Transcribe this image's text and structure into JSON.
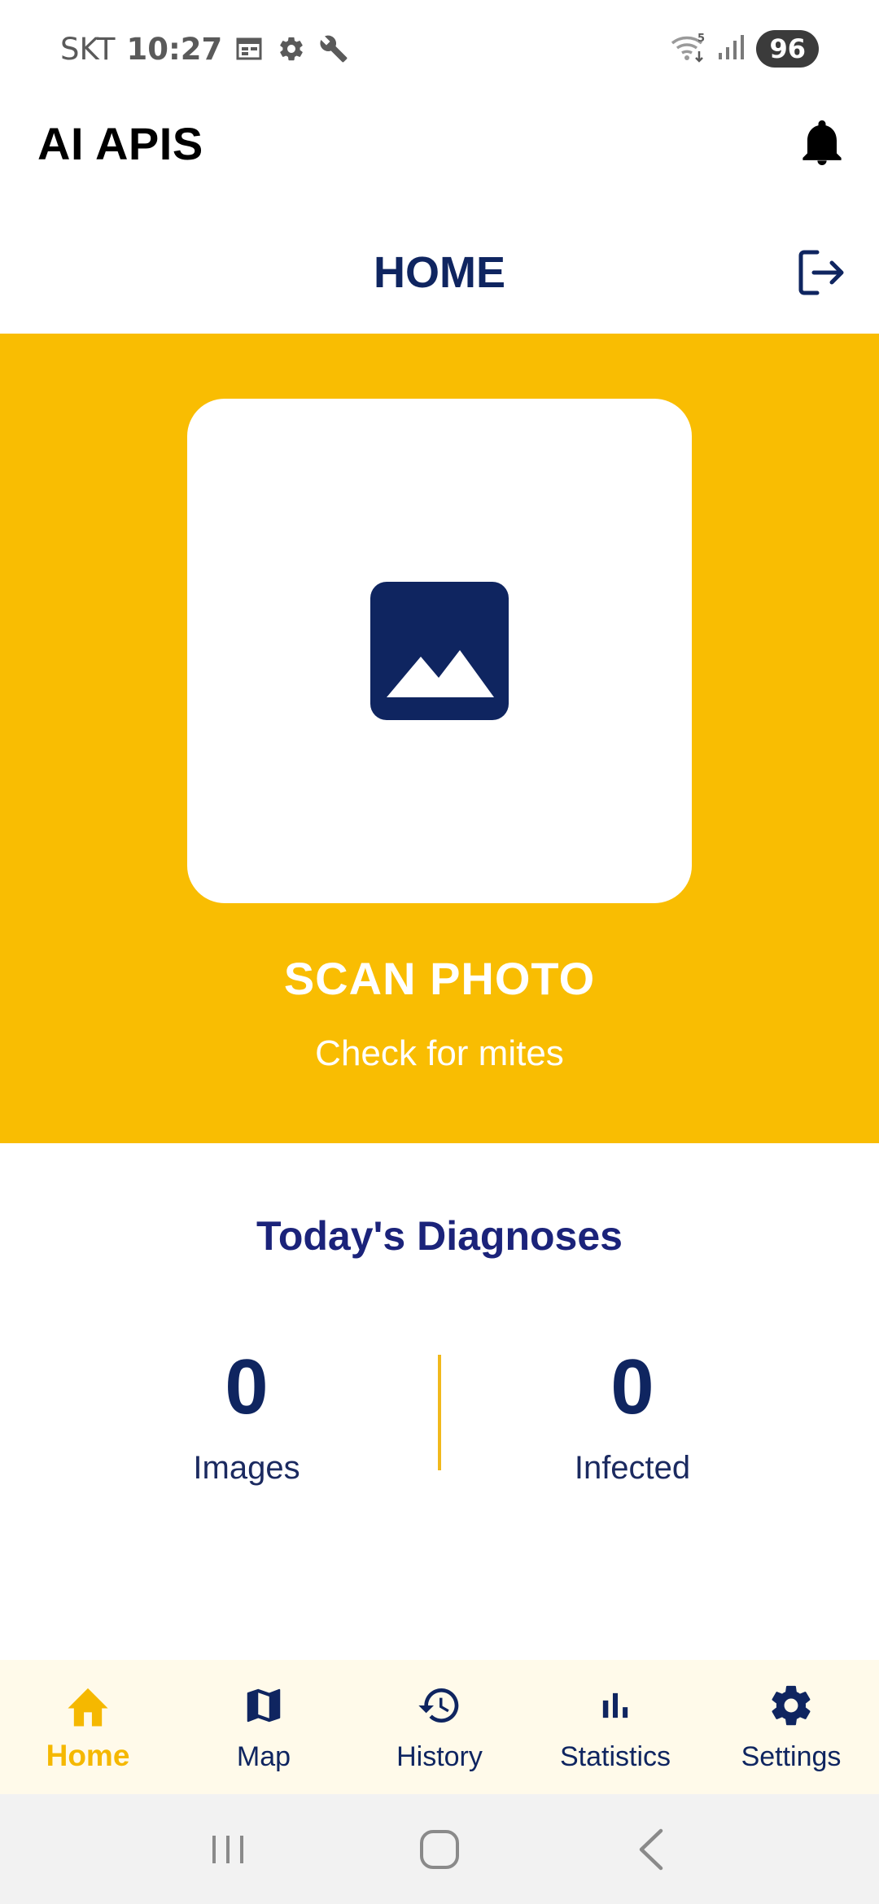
{
  "status_bar": {
    "carrier": "SKT",
    "time": "10:27",
    "battery": "96",
    "icons": [
      "calendar-icon",
      "gear-icon",
      "wrench-icon",
      "wifi-icon",
      "signal-icon"
    ]
  },
  "app": {
    "title": "AI APIS"
  },
  "page": {
    "title": "HOME"
  },
  "scan": {
    "title": "SCAN PHOTO",
    "subtitle": "Check for mites",
    "icon": "image-icon"
  },
  "diagnoses": {
    "title": "Today's Diagnoses",
    "images_count": "0",
    "images_label": "Images",
    "infected_count": "0",
    "infected_label": "Infected"
  },
  "nav": {
    "items": [
      {
        "label": "Home",
        "icon": "home-icon",
        "active": true
      },
      {
        "label": "Map",
        "icon": "map-icon",
        "active": false
      },
      {
        "label": "History",
        "icon": "history-icon",
        "active": false
      },
      {
        "label": "Statistics",
        "icon": "bar-chart-icon",
        "active": false
      },
      {
        "label": "Settings",
        "icon": "gear-icon",
        "active": false
      }
    ]
  },
  "colors": {
    "primary": "#0f2560",
    "accent": "#f9bd02",
    "nav_background": "#fffaea"
  }
}
